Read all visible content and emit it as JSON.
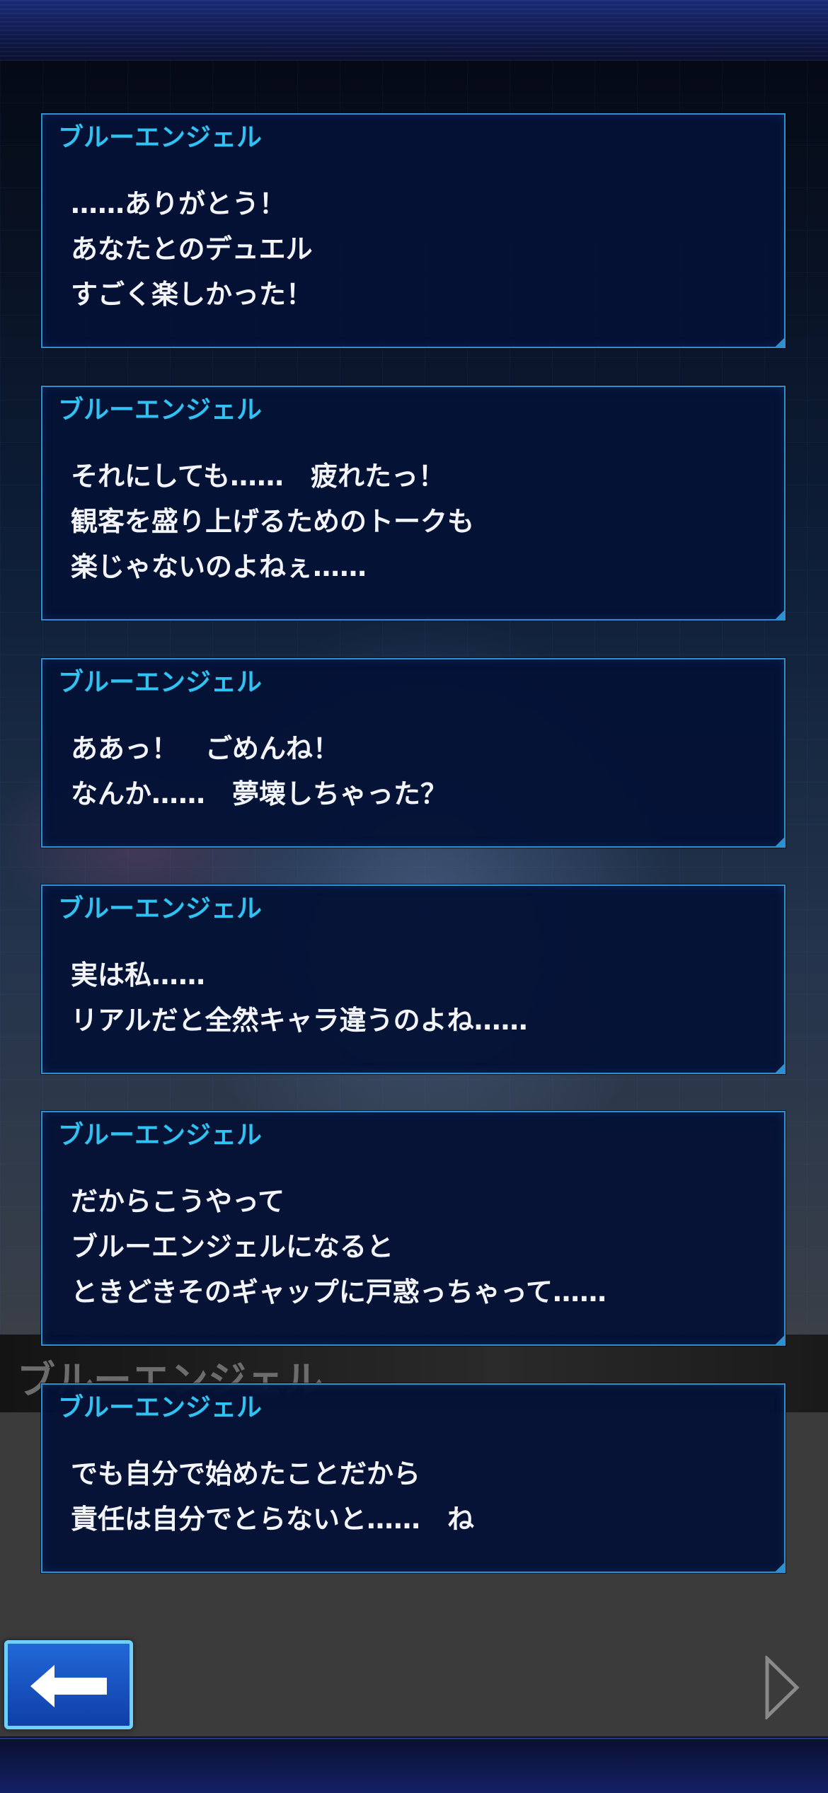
{
  "background": {
    "nameplate": "ブルーエンジェル"
  },
  "dialog_log": [
    {
      "speaker": "ブルーエンジェル",
      "lines": [
        "……ありがとう！",
        "あなたとのデュエル",
        "すごく楽しかった！"
      ]
    },
    {
      "speaker": "ブルーエンジェル",
      "lines": [
        "それにしても……　疲れたっ！",
        "観客を盛り上げるためのトークも",
        "楽じゃないのよねぇ……"
      ]
    },
    {
      "speaker": "ブルーエンジェル",
      "lines": [
        "ああっ！　ごめんね！",
        "なんか……　夢壊しちゃった？"
      ]
    },
    {
      "speaker": "ブルーエンジェル",
      "lines": [
        "実は私……",
        "リアルだと全然キャラ違うのよね……"
      ]
    },
    {
      "speaker": "ブルーエンジェル",
      "lines": [
        "だからこうやって",
        "ブルーエンジェルになると",
        "ときどきそのギャップに戸惑っちゃって……"
      ]
    },
    {
      "speaker": "ブルーエンジェル",
      "lines": [
        "でも自分で始めたことだから",
        "責任は自分でとらないと……　ね"
      ]
    }
  ],
  "controls": {
    "back_icon": "left-arrow-icon",
    "next_icon": "right-triangle-icon"
  },
  "colors": {
    "speaker_name": "#2fc2f2",
    "card_border": "#2f8fd0",
    "card_fill": "#041236",
    "back_button": "#1a55c8"
  }
}
